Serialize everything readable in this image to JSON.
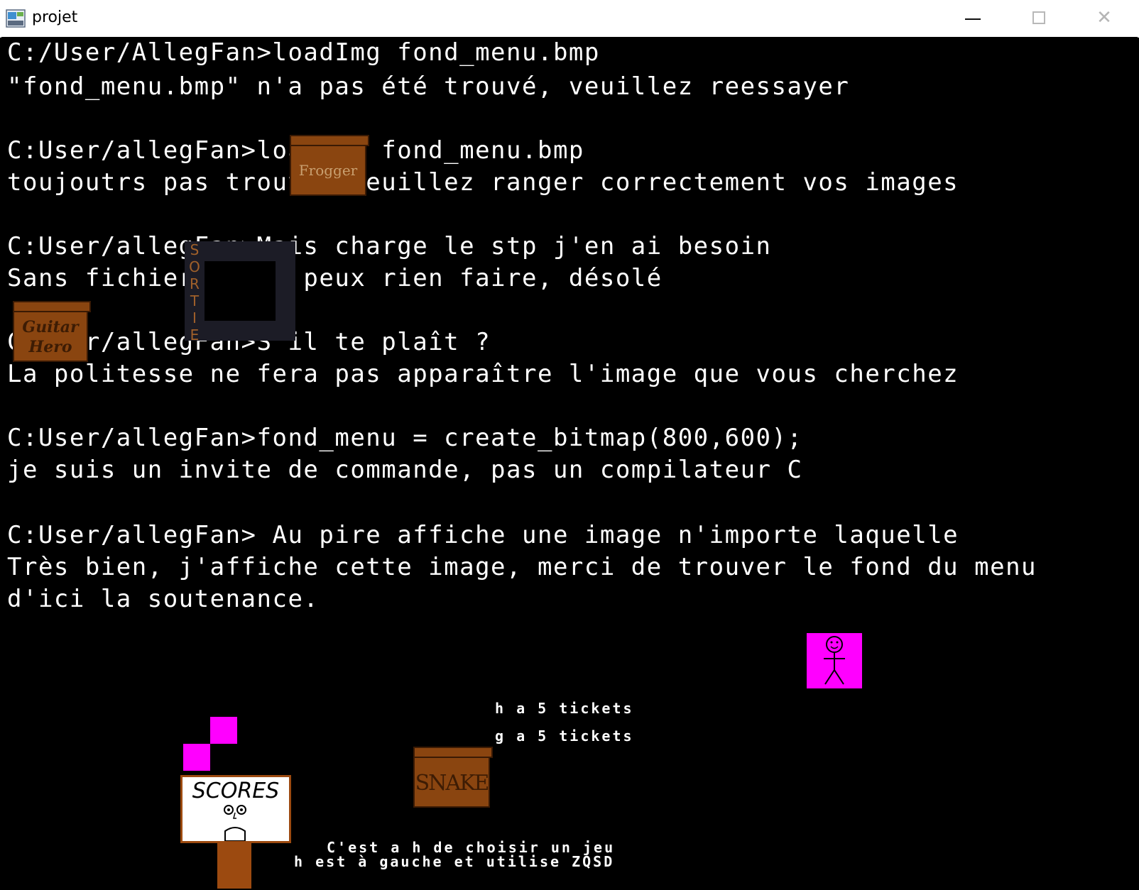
{
  "window": {
    "title": "projet",
    "controls": {
      "minimize": "—",
      "maximize": "☐",
      "close": "✕"
    }
  },
  "terminal": {
    "lines": [
      "C:/User/AllegFan>loadImg fond_menu.bmp",
      "\"fond_menu.bmp\" n'a pas été trouvé, veuillez reessayer",
      "C:User/allegFan>loadImg fond_menu.bmp",
      "toujoutrs pas trouvé, veuillez ranger correctement vos images",
      "C:User/allegFan>Mais charge le stp j'en ai besoin",
      "Sans fichier je ne peux rien faire, désolé",
      "C:User/allegFan>S'il te plaît ?",
      "La politesse ne fera pas apparaître l'image que vous cherchez",
      "C:User/allegFan>fond_menu = create_bitmap(800,600);",
      "je suis un invite de commande, pas un compilateur C",
      "C:User/allegFan> Au pire affiche une image n'importe laquelle",
      "Très bien, j'affiche cette image, merci de trouver le fond du menu",
      "d'ici la soutenance."
    ]
  },
  "game": {
    "signs": {
      "frogger": "Frogger",
      "guitar_hero_line1": "Guitar",
      "guitar_hero_line2": "Hero",
      "snake": "SNAKE",
      "sortie": [
        "S",
        "O",
        "R",
        "T",
        "I",
        "E"
      ],
      "scores": "SCORES"
    },
    "tickets": {
      "h": "h a 5 tickets",
      "g": "g a 5 tickets"
    },
    "instructions": {
      "line1": "C'est a h de choisir un jeu",
      "line2": "h est à gauche et utilise ZQSD"
    },
    "colors": {
      "sign_wood": "#8a4510",
      "player": "#ff00ff",
      "background": "#000000"
    }
  }
}
